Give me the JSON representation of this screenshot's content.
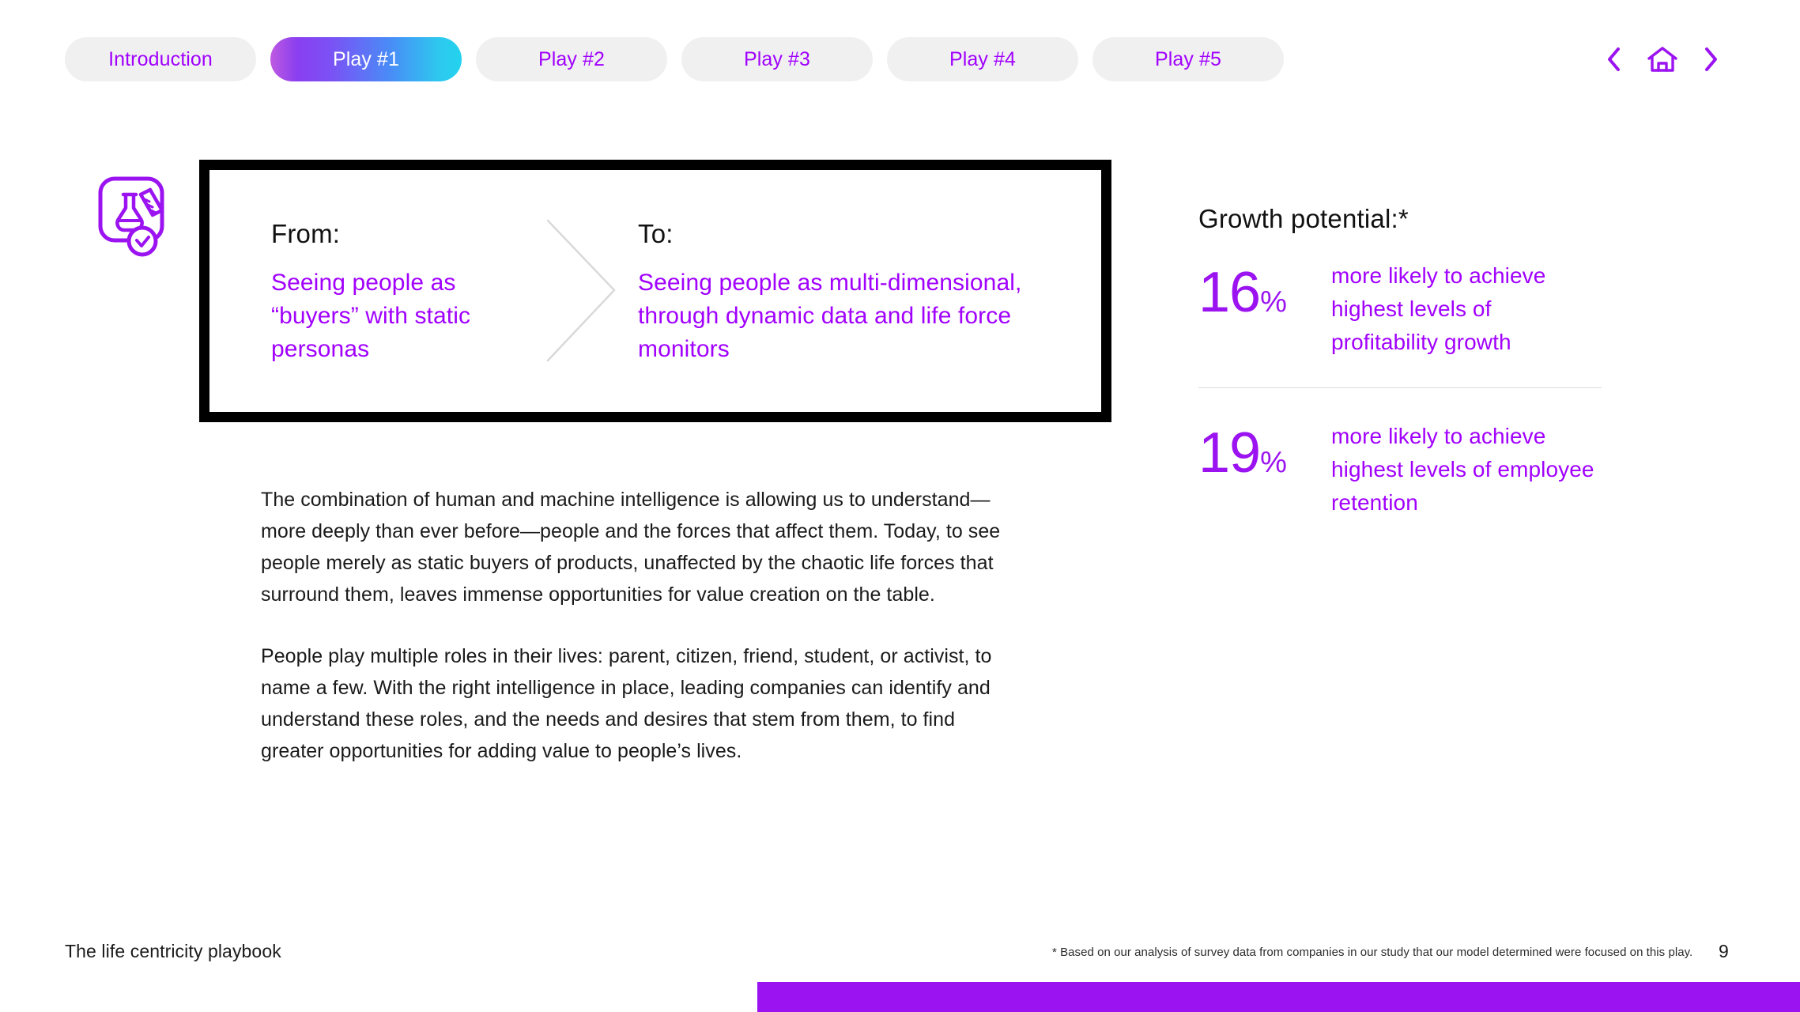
{
  "nav": {
    "tabs": [
      {
        "label": "Introduction",
        "active": false
      },
      {
        "label": "Play #1",
        "active": true
      },
      {
        "label": "Play #2",
        "active": false
      },
      {
        "label": "Play #3",
        "active": false
      },
      {
        "label": "Play #4",
        "active": false
      },
      {
        "label": "Play #5",
        "active": false
      }
    ],
    "prev_label": "Previous",
    "home_label": "Home",
    "next_label": "Next"
  },
  "icon": {
    "name": "lab-flask-test-tube-icon",
    "badge": "check-circle-badge"
  },
  "fromto": {
    "from_label": "From:",
    "from_text": "Seeing people as “buyers” with static personas",
    "to_label": "To:",
    "to_text": "Seeing people as multi-dimensional, through dynamic data and life force monitors",
    "divider_icon": "chevron-right-large-icon"
  },
  "body": {
    "paragraph_1": "The combination of human and machine intelligence is allowing us to understand—more deeply than ever before—people and the forces that affect them. Today, to see people merely as static buyers of products, unaffected by the chaotic life forces that surround them, leaves immense opportunities for value creation on the table.",
    "paragraph_2": "People play multiple roles in their lives: parent, citizen, friend, student, or activist, to name a few. With the right intelligence in place, leading companies can identify and understand these roles, and the needs and desires that stem from them, to find greater opportunities for adding value to people’s lives."
  },
  "stats": {
    "title": "Growth potential:*",
    "items": [
      {
        "number": "16",
        "percent": "%",
        "description": "more likely to achieve highest levels of profitability growth"
      },
      {
        "number": "19",
        "percent": "%",
        "description": "more likely to achieve highest levels of employee retention"
      }
    ]
  },
  "footer": {
    "title": "The life centricity playbook",
    "note": "* Based on our analysis of survey data from companies in our study that our model determined were focused on this play.",
    "page": "9"
  },
  "colors": {
    "accent_purple": "#a100ff",
    "number_purple": "#9b13f0",
    "tab_bg": "#f0f0f0",
    "progress_fill": "#9b13f0",
    "frame": "#000000"
  }
}
